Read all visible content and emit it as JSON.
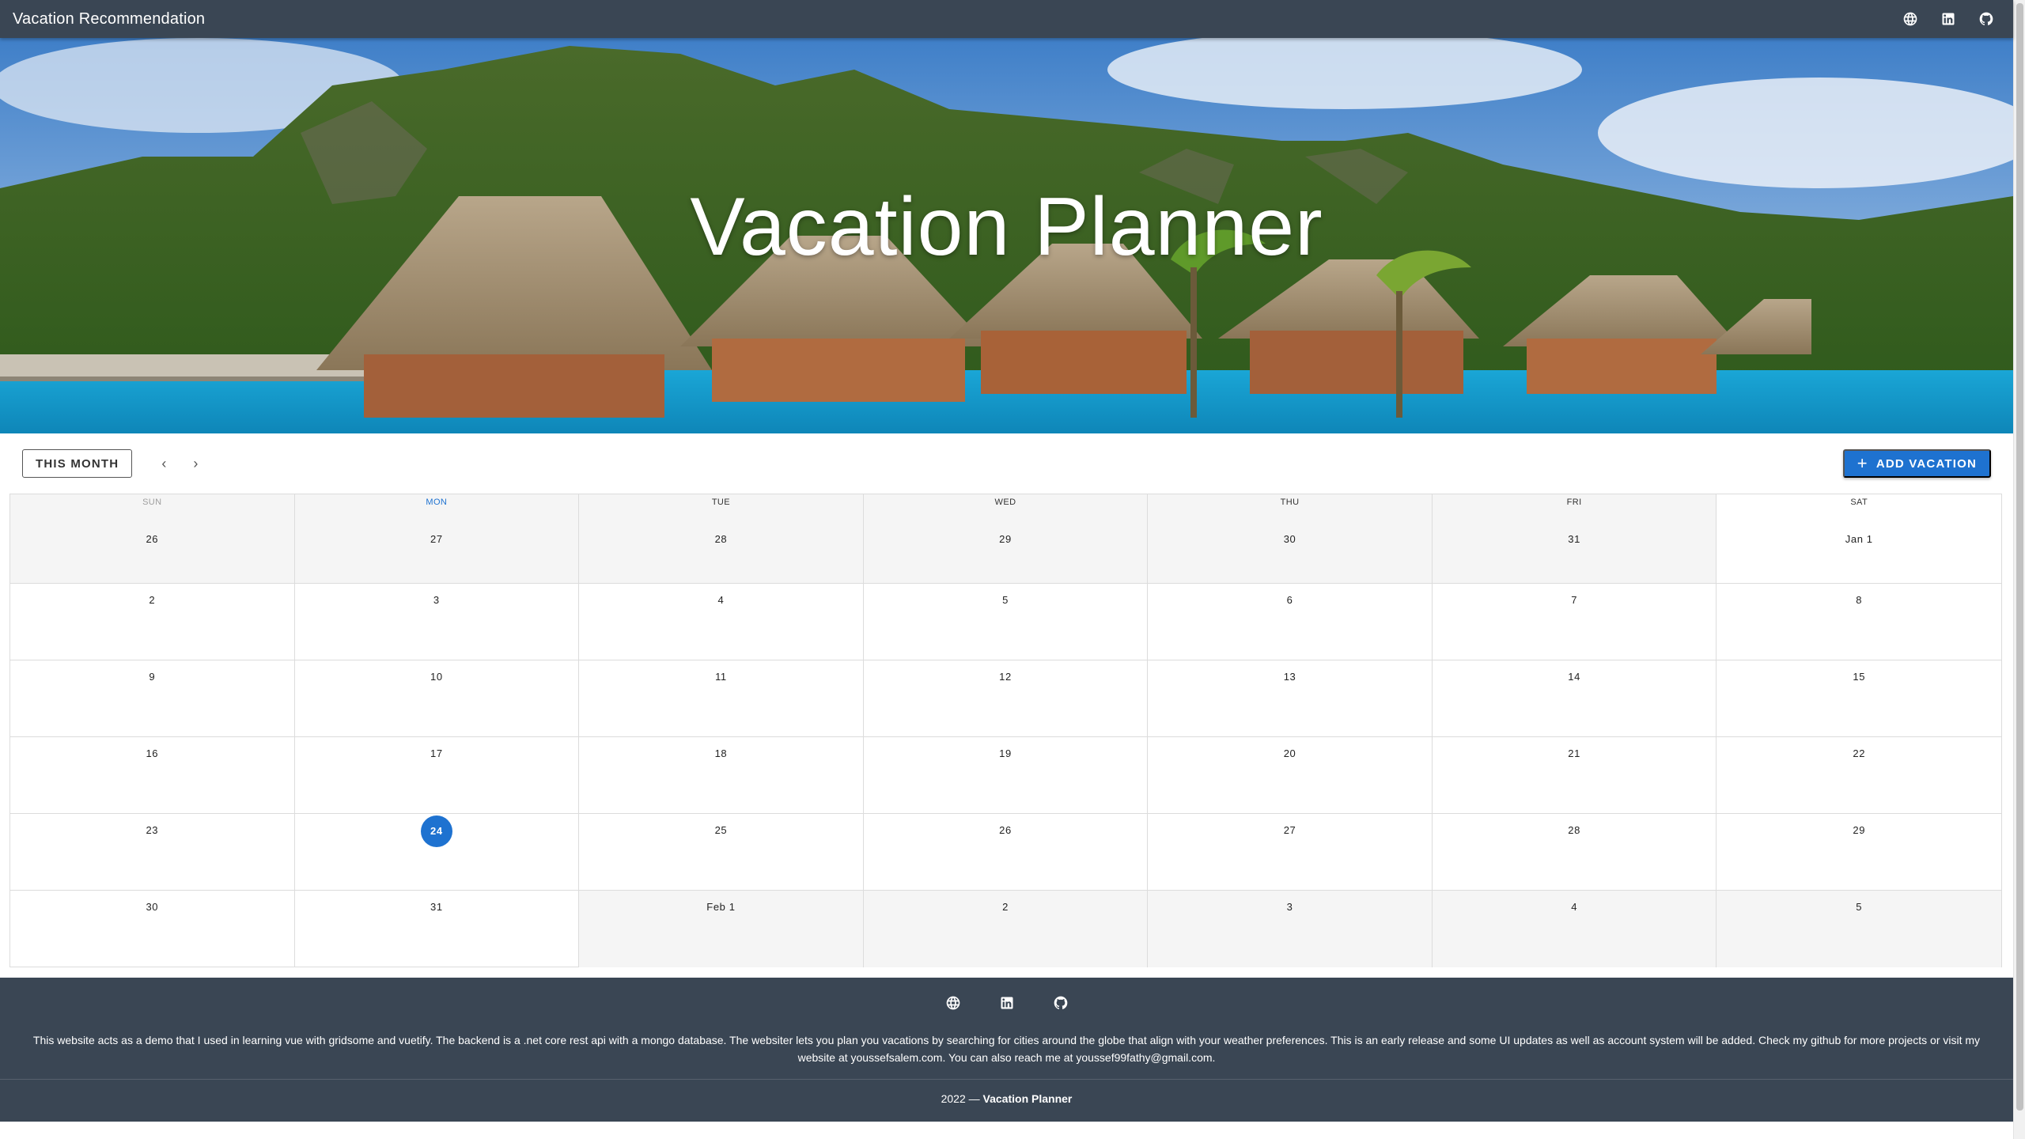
{
  "appbar": {
    "title": "Vacation Recommendation",
    "icons": [
      "globe-icon",
      "linkedin-icon",
      "github-icon"
    ]
  },
  "hero": {
    "title": "Vacation Planner"
  },
  "toolbar": {
    "this_month_label": "THIS MONTH",
    "prev_label": "‹",
    "next_label": "›",
    "add_vacation_label": "ADD VACATION",
    "add_icon": "plus-icon"
  },
  "calendar": {
    "weekdays": [
      "SUN",
      "MON",
      "TUE",
      "WED",
      "THU",
      "FRI",
      "SAT"
    ],
    "today_weekday_index": 1,
    "weeks": [
      [
        {
          "label": "26",
          "outside": true
        },
        {
          "label": "27",
          "outside": true
        },
        {
          "label": "28",
          "outside": true
        },
        {
          "label": "29",
          "outside": true
        },
        {
          "label": "30",
          "outside": true
        },
        {
          "label": "31",
          "outside": true
        },
        {
          "label": "Jan 1",
          "outside": false
        }
      ],
      [
        {
          "label": "2"
        },
        {
          "label": "3"
        },
        {
          "label": "4"
        },
        {
          "label": "5"
        },
        {
          "label": "6"
        },
        {
          "label": "7"
        },
        {
          "label": "8"
        }
      ],
      [
        {
          "label": "9"
        },
        {
          "label": "10"
        },
        {
          "label": "11"
        },
        {
          "label": "12"
        },
        {
          "label": "13"
        },
        {
          "label": "14"
        },
        {
          "label": "15"
        }
      ],
      [
        {
          "label": "16"
        },
        {
          "label": "17"
        },
        {
          "label": "18"
        },
        {
          "label": "19"
        },
        {
          "label": "20"
        },
        {
          "label": "21"
        },
        {
          "label": "22"
        }
      ],
      [
        {
          "label": "23"
        },
        {
          "label": "24",
          "today": true
        },
        {
          "label": "25"
        },
        {
          "label": "26"
        },
        {
          "label": "27"
        },
        {
          "label": "28"
        },
        {
          "label": "29"
        }
      ],
      [
        {
          "label": "30"
        },
        {
          "label": "31"
        },
        {
          "label": "Feb 1",
          "outside": true
        },
        {
          "label": "2",
          "outside": true
        },
        {
          "label": "3",
          "outside": true
        },
        {
          "label": "4",
          "outside": true
        },
        {
          "label": "5",
          "outside": true
        }
      ]
    ]
  },
  "footer": {
    "icons": [
      "globe-icon",
      "linkedin-icon",
      "github-icon"
    ],
    "description_line1": "This website acts as a demo that I used in learning vue with gridsome and vuetify. The backend is a .net core rest api with a mongo database. The websiter lets you plan you vacations by searching for cities around the globe that align with your weather preferences. This is an early release and some UI updates as well as account system will be added. Check my github for more projects or visit my",
    "description_line2": "website at youssefsalem.com. You can also reach me at youssef99fathy@gmail.com.",
    "copyright_year": "2022 —",
    "copyright_name": "Vacation Planner"
  },
  "colors": {
    "appbar_bg": "#3a4654",
    "primary": "#1e72d0",
    "outside_day_bg": "#f5f5f5"
  }
}
